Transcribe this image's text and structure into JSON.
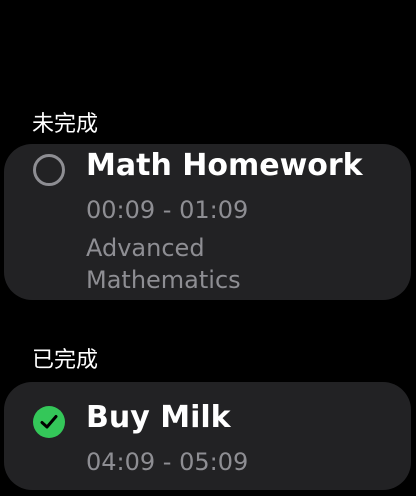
{
  "sections": [
    {
      "header": "未完成",
      "tasks": [
        {
          "title": "Math Homework",
          "time": "00:09 - 01:09",
          "subject": "Advanced Mathematics",
          "completed": false
        }
      ]
    },
    {
      "header": "已完成",
      "tasks": [
        {
          "title": "Buy Milk",
          "time": "04:09 - 05:09",
          "completed": true
        }
      ]
    }
  ],
  "colors": {
    "background": "#000000",
    "card": "#222224",
    "secondary_text": "#8e8e93",
    "complete_green": "#34c759",
    "open_circle": "#8e8e93"
  },
  "icons": {
    "incomplete": "empty-circle-icon",
    "complete": "checkmark-circle-icon"
  }
}
